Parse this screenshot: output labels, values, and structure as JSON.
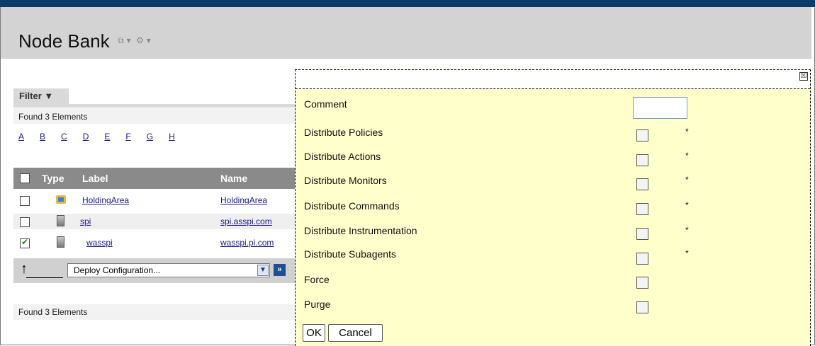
{
  "page": {
    "title": "Node Bank",
    "title_icons": [
      "view-icon",
      "chevron-down-icon",
      "gear-icon",
      "chevron-down-icon"
    ]
  },
  "filter": {
    "label": "Filter ▼"
  },
  "found_top": "Found 3 Elements",
  "found_bottom": "Found 3 Elements",
  "letters": [
    "A",
    "B",
    "C",
    "D",
    "E",
    "F",
    "G",
    "H"
  ],
  "table": {
    "headers": {
      "type": "Type",
      "label": "Label",
      "name": "Name"
    },
    "rows": [
      {
        "label": "HoldingArea",
        "name": "HoldingArea",
        "checked": false,
        "icon": "folder-icon"
      },
      {
        "label": "spi",
        "name": "spi.asspi.com",
        "checked": false,
        "icon": "server-icon"
      },
      {
        "label": "wasspi",
        "name": "wasspi.pi.com",
        "checked": true,
        "icon": "server-icon"
      }
    ]
  },
  "action": {
    "selected": "Deploy Configuration...",
    "go_label": "»"
  },
  "dialog": {
    "close_label": "☒",
    "comment_label": "Comment",
    "options": [
      {
        "label": "Distribute Policies",
        "required": "*"
      },
      {
        "label": "Distribute Actions",
        "required": "*"
      },
      {
        "label": "Distribute Monitors",
        "required": "*"
      },
      {
        "label": "Distribute Commands",
        "required": "*"
      },
      {
        "label": "Distribute Instrumentation",
        "required": "*"
      },
      {
        "label": "Distribute Subagents",
        "required": "*"
      },
      {
        "label": "Force",
        "required": ""
      },
      {
        "label": "Purge",
        "required": ""
      }
    ],
    "ok_label": "OK",
    "cancel_label": "Cancel"
  }
}
